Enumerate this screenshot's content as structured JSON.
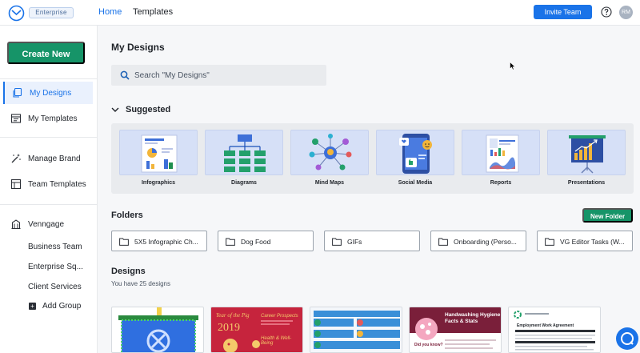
{
  "header": {
    "badge": "Enterprise",
    "nav": {
      "home": "Home",
      "templates": "Templates"
    },
    "invite_label": "Invite Team",
    "avatar_initials": "RM",
    "accent": "#1a73e8"
  },
  "sidebar": {
    "create_label": "Create New",
    "items": [
      {
        "label": "My Designs",
        "icon": "designs-icon"
      },
      {
        "label": "My Templates",
        "icon": "templates-icon"
      },
      {
        "label": "Manage Brand",
        "icon": "magic-wand-icon"
      },
      {
        "label": "Team Templates",
        "icon": "grid-icon"
      },
      {
        "label": "Venngage",
        "icon": "building-icon"
      }
    ],
    "teams": [
      "Business Team",
      "Enterprise Sq...",
      "Client Services"
    ],
    "add_group_label": "Add Group",
    "brand_green": "#169468"
  },
  "main": {
    "title": "My Designs",
    "search_placeholder": "Search \"My Designs\"",
    "suggested_label": "Suggested",
    "suggested": [
      "Infographics",
      "Diagrams",
      "Mind Maps",
      "Social Media",
      "Reports",
      "Presentations"
    ],
    "folders_label": "Folders",
    "new_folder_label": "New Folder",
    "folders": [
      "5X5 Infographic Ch...",
      "Dog Food",
      "GIFs",
      "Onboarding (Perso...",
      "VG Editor Tasks (W..."
    ],
    "designs_label": "Designs",
    "designs_count": "You have 25 designs",
    "design_thumbs": {
      "t2_title": "Year of the Pig",
      "t2_year": "2019",
      "t2_sub1": "Career Prospects",
      "t2_sub2": "Health & Well-Being",
      "t4_title": "Handwashing Hygiene Facts & Stats",
      "t4_q": "Did you know?",
      "t5_title": "Employment Work Agreement"
    }
  }
}
